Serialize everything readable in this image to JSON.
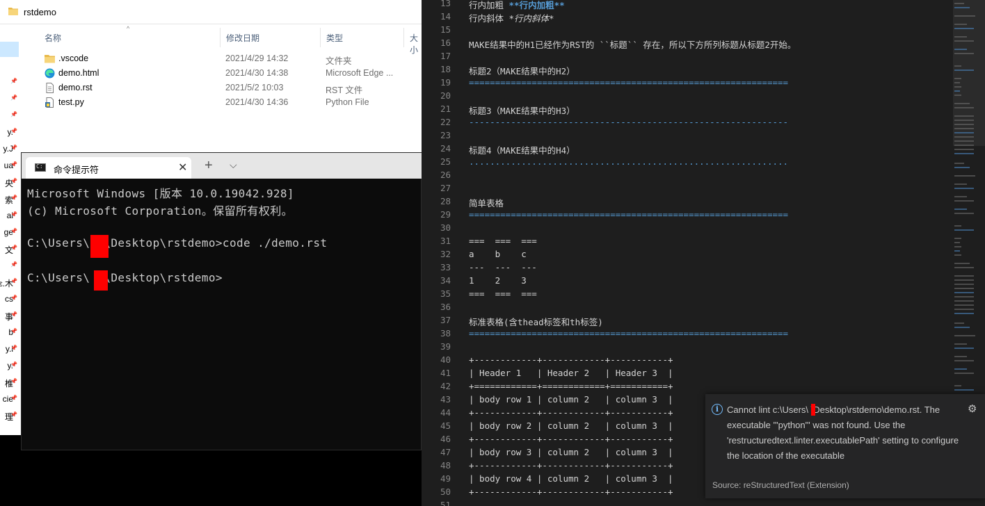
{
  "explorer": {
    "title": "rstdemo",
    "columns": {
      "name": "名称",
      "modified": "修改日期",
      "type": "类型",
      "size": "大小"
    },
    "files": [
      {
        "name": ".vscode",
        "date": "2021/4/29 14:32",
        "type": "文件夹",
        "icon": "folder-icon"
      },
      {
        "name": "demo.html",
        "date": "2021/4/30 14:38",
        "type": "Microsoft Edge ...",
        "icon": "edge-icon"
      },
      {
        "name": "demo.rst",
        "date": "2021/5/2 10:03",
        "type": "RST 文件",
        "icon": "file-icon"
      },
      {
        "name": "test.py",
        "date": "2021/4/30 14:36",
        "type": "Python File",
        "icon": "python-file-icon"
      }
    ],
    "nav_items": [
      "",
      "",
      "",
      "",
      "",
      "",
      "y.",
      "y.J",
      "ua",
      "央",
      "索",
      "al",
      "ge",
      "文",
      "",
      "ε.木",
      "cs",
      "事",
      "b",
      "y.l",
      "y.",
      "椎",
      "cie",
      "理"
    ]
  },
  "cmd": {
    "tab_title": "命令提示符",
    "lines": [
      "Microsoft Windows [版本 10.0.19042.928]",
      "(c) Microsoft Corporation。保留所有权利。",
      "",
      "C:\\Users\\  \\Desktop\\rstdemo>code ./demo.rst",
      "",
      "C:\\Users\\  \\Desktop\\rstdemo>"
    ]
  },
  "editor": {
    "lines": [
      {
        "n": "13",
        "t": "行内加粗 ",
        "bold": "**行内加粗**"
      },
      {
        "n": "14",
        "t": "行内斜体 ",
        "italic": "*行内斜体*"
      },
      {
        "n": "15",
        "t": ""
      },
      {
        "n": "16",
        "t": "MAKE结果中的H1已经作为RST的 ``标题`` 存在，所以下方所列标题从标题2开始。"
      },
      {
        "n": "17",
        "t": ""
      },
      {
        "n": "18",
        "t": "标题2（MAKE结果中的H2）"
      },
      {
        "n": "19",
        "t": "=============================================================",
        "u": true
      },
      {
        "n": "20",
        "t": ""
      },
      {
        "n": "21",
        "t": "标题3（MAKE结果中的H3）"
      },
      {
        "n": "22",
        "t": "-------------------------------------------------------------",
        "u": true
      },
      {
        "n": "23",
        "t": ""
      },
      {
        "n": "24",
        "t": "标题4（MAKE结果中的H4）"
      },
      {
        "n": "25",
        "t": ".............................................................",
        "u": true
      },
      {
        "n": "26",
        "t": ""
      },
      {
        "n": "27",
        "t": ""
      },
      {
        "n": "28",
        "t": "简单表格"
      },
      {
        "n": "29",
        "t": "=============================================================",
        "u": true
      },
      {
        "n": "30",
        "t": ""
      },
      {
        "n": "31",
        "t": "===  ===  ==="
      },
      {
        "n": "32",
        "t": "a    b    c"
      },
      {
        "n": "33",
        "t": "---  ---  ---"
      },
      {
        "n": "34",
        "t": "1    2    3"
      },
      {
        "n": "35",
        "t": "===  ===  ==="
      },
      {
        "n": "36",
        "t": ""
      },
      {
        "n": "37",
        "t": "标准表格(含thead标签和th标签)"
      },
      {
        "n": "38",
        "t": "=============================================================",
        "u": true
      },
      {
        "n": "39",
        "t": ""
      },
      {
        "n": "40",
        "t": "+------------+------------+-----------+"
      },
      {
        "n": "41",
        "t": "| Header 1   | Header 2   | Header 3  |"
      },
      {
        "n": "42",
        "t": "+============+============+===========+"
      },
      {
        "n": "43",
        "t": "| body row 1 | column 2   | column 3  |"
      },
      {
        "n": "44",
        "t": "+------------+------------+-----------+"
      },
      {
        "n": "45",
        "t": "| body row 2 | column 2   | column 3  |"
      },
      {
        "n": "46",
        "t": "+------------+------------+-----------+"
      },
      {
        "n": "47",
        "t": "| body row 3 | column 2   | column 3  |"
      },
      {
        "n": "48",
        "t": "+------------+------------+-----------+"
      },
      {
        "n": "49",
        "t": "| body row 4 | column 2   | column 3  |"
      },
      {
        "n": "50",
        "t": "+------------+------------+-----------+"
      },
      {
        "n": "51",
        "t": ""
      }
    ]
  },
  "notification": {
    "message": "Cannot lint c:\\Users\\  \\Desktop\\rstdemo\\demo.rst. The executable '\"python\"' was not found. Use the 'restructuredtext.linter.executablePath' setting to configure the location of the executable",
    "source": "Source: reStructuredText (Extension)"
  },
  "colors": {
    "accent_blue": "#569cd6",
    "redaction": "#ff0000",
    "terminal_bg": "#0c0c0c",
    "editor_bg": "#1e1e1e"
  }
}
